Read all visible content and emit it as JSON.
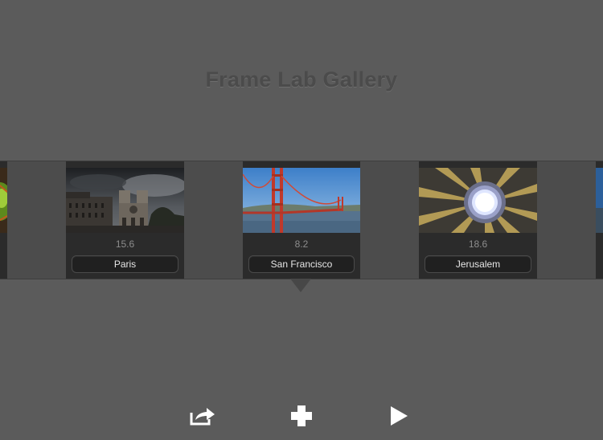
{
  "app": {
    "title": "Frame Lab Gallery"
  },
  "gallery": {
    "items": [
      {
        "name": "Paris",
        "value": "15.6"
      },
      {
        "name": "San Francisco",
        "value": "8.2"
      },
      {
        "name": "Jerusalem",
        "value": "18.6"
      }
    ]
  },
  "toolbar": {
    "share_icon": "share-icon",
    "add_icon": "plus-icon",
    "play_icon": "play-icon"
  },
  "colors": {
    "background": "#5b5b5b",
    "card": "#2b2b2b",
    "title": "#4b4b4b"
  }
}
